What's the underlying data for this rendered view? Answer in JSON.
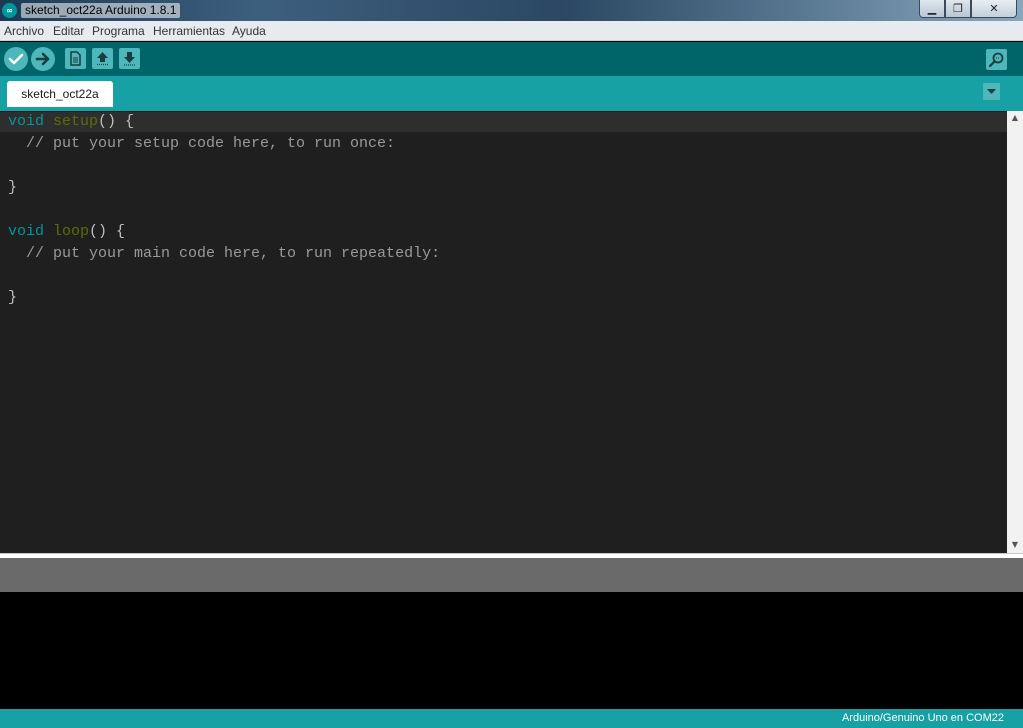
{
  "window": {
    "title": "sketch_oct22a Arduino 1.8.1",
    "app_icon_text": "∞"
  },
  "window_controls": {
    "minimize": "▁",
    "maximize": "❐",
    "close": "✕"
  },
  "menu": {
    "items": [
      "Archivo",
      "Editar",
      "Programa",
      "Herramientas",
      "Ayuda"
    ]
  },
  "toolbar": {
    "buttons": [
      {
        "name": "verify",
        "icon": "check-icon"
      },
      {
        "name": "upload",
        "icon": "arrow-right-icon"
      },
      {
        "name": "new",
        "icon": "document-icon"
      },
      {
        "name": "open",
        "icon": "arrow-up-icon"
      },
      {
        "name": "save",
        "icon": "arrow-down-icon"
      },
      {
        "name": "serial-monitor",
        "icon": "magnifier-icon"
      }
    ]
  },
  "tabs": [
    {
      "label": "sketch_oct22a"
    }
  ],
  "editor": {
    "lines": [
      {
        "type": "void",
        "fn": "setup",
        "rest": "() {"
      },
      {
        "comment": "  // put your setup code here, to run once:"
      },
      {
        "text": ""
      },
      {
        "text": "}"
      },
      {
        "text": ""
      },
      {
        "type": "void",
        "fn": "loop",
        "rest": "() {"
      },
      {
        "comment": "  // put your main code here, to run repeatedly:"
      },
      {
        "text": ""
      },
      {
        "text": "}"
      }
    ]
  },
  "status": {
    "board": "Arduino/Genuino Uno en COM22"
  },
  "colors": {
    "teal_dark": "#006468",
    "teal": "#17a1a5",
    "button": "#4db7bb",
    "editor_bg": "#1f1f1f",
    "keyword_type": "#00979c",
    "keyword_function": "#5e6d03"
  }
}
